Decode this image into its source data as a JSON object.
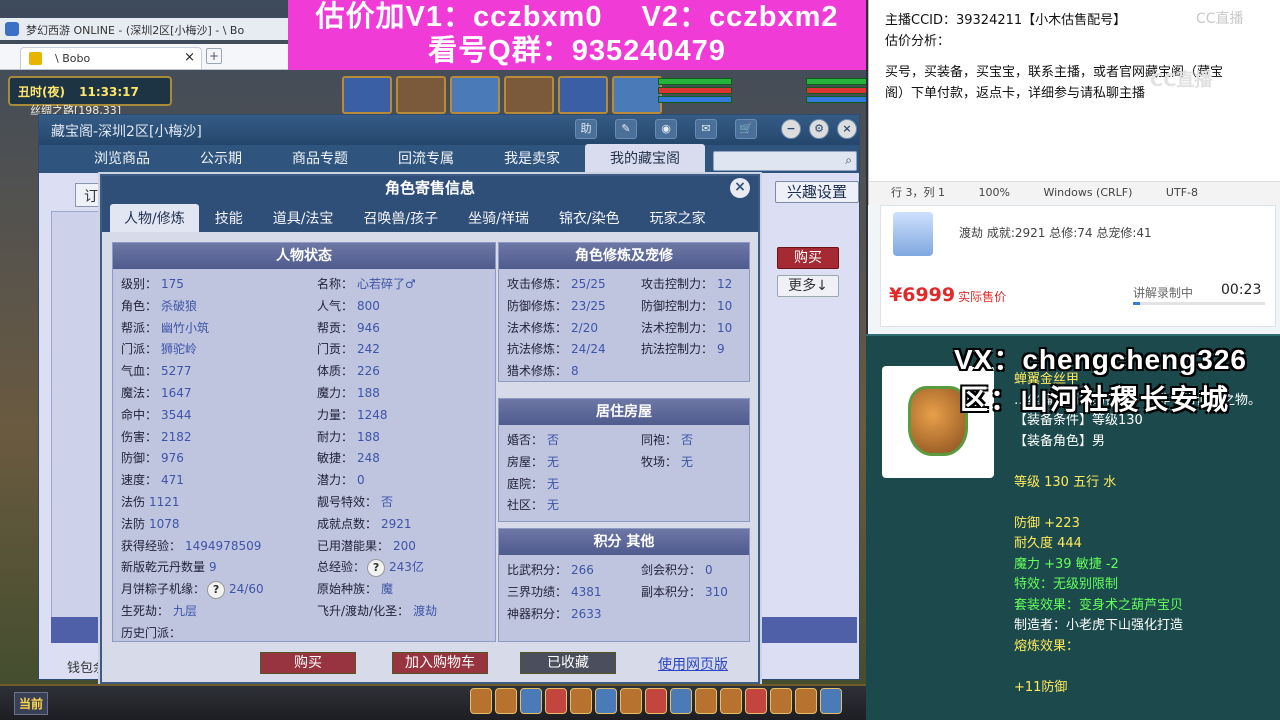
{
  "window": {
    "title": "梦幻西游 ONLINE - (深圳2区[小梅沙] - \\ Bo",
    "tab_label": "\\ Bobo",
    "tab_close": "×",
    "new_tab": "+"
  },
  "banner": {
    "line1": "估价加V1：cczbxm0　 V2：cczbxm2",
    "line2": "看号Q群：935240479"
  },
  "game": {
    "time_period": "丑时(夜)",
    "clock": "11:33:17",
    "map": "丝绸之路[198,33]"
  },
  "cbg": {
    "title": "藏宝阁-深圳2区[小梅沙]",
    "ctl_help": "助",
    "nav_tabs": [
      "浏览商品",
      "公示期",
      "商品专题",
      "回流专属",
      "我是卖家",
      "我的藏宝阁"
    ],
    "left_btn": "订单",
    "interest_btn": "兴趣设置",
    "buy_btn": "购买",
    "more_btn": "更多↓",
    "wallet": "钱包余额"
  },
  "modal": {
    "title": "角色寄售信息",
    "close": "×",
    "tabs": [
      "人物/修炼",
      "技能",
      "道具/法宝",
      "召唤兽/孩子",
      "坐骑/祥瑞",
      "锦衣/染色",
      "玩家之家"
    ],
    "status_header": "人物状态",
    "left_col": [
      {
        "k": "级别：",
        "v": "175"
      },
      {
        "k": "角色：",
        "v": "杀破狼"
      },
      {
        "k": "帮派：",
        "v": "幽竹小筑"
      },
      {
        "k": "门派：",
        "v": "狮驼岭"
      },
      {
        "k": "气血：",
        "v": "5277"
      },
      {
        "k": "魔法：",
        "v": "1647"
      },
      {
        "k": "命中：",
        "v": "3544"
      },
      {
        "k": "伤害：",
        "v": "2182"
      },
      {
        "k": "防御：",
        "v": "976"
      },
      {
        "k": "速度：",
        "v": "471"
      },
      {
        "k": "法伤",
        "v": "1121"
      },
      {
        "k": "法防",
        "v": "1078"
      },
      {
        "k": "获得经验：",
        "v": "1494978509"
      },
      {
        "k": "新版乾元丹数量",
        "v": "9"
      },
      {
        "k": "月饼粽子机缘：",
        "v": "24/60"
      },
      {
        "k": "生死劫：",
        "v": "九层"
      },
      {
        "k": "历史门派：",
        "v": ""
      }
    ],
    "mid_col": [
      {
        "k": "名称：",
        "v": "心若碎了♂"
      },
      {
        "k": "人气：",
        "v": "800"
      },
      {
        "k": "帮贡：",
        "v": "946"
      },
      {
        "k": "门贡：",
        "v": "242"
      },
      {
        "k": "体质：",
        "v": "226"
      },
      {
        "k": "魔力：",
        "v": "188"
      },
      {
        "k": "力量：",
        "v": "1248"
      },
      {
        "k": "耐力：",
        "v": "188"
      },
      {
        "k": "敏捷：",
        "v": "248"
      },
      {
        "k": "潜力：",
        "v": "0"
      },
      {
        "k": "靓号特效：",
        "v": "否"
      },
      {
        "k": "成就点数：",
        "v": "2921"
      },
      {
        "k": "已用潜能果：",
        "v": "200"
      },
      {
        "k": "总经验：",
        "v": "243亿"
      },
      {
        "k": "原始种族：",
        "v": "魔"
      },
      {
        "k": "飞升/渡劫/化圣：",
        "v": "渡劫"
      }
    ],
    "cultivation_header": "角色修炼及宠修",
    "cultivation": [
      {
        "k": "攻击修炼：",
        "v": "25/25",
        "k2": "攻击控制力：",
        "v2": "12"
      },
      {
        "k": "防御修炼：",
        "v": "23/25",
        "k2": "防御控制力：",
        "v2": "10"
      },
      {
        "k": "法术修炼：",
        "v": "2/20",
        "k2": "法术控制力：",
        "v2": "10"
      },
      {
        "k": "抗法修炼：",
        "v": "24/24",
        "k2": "抗法控制力：",
        "v2": "9"
      },
      {
        "k": "猎术修炼：",
        "v": "8",
        "k2": "",
        "v2": ""
      }
    ],
    "house_header": "居住房屋",
    "house": [
      {
        "k": "婚否：",
        "v": "否",
        "k2": "同袍：",
        "v2": "否"
      },
      {
        "k": "房屋：",
        "v": "无",
        "k2": "牧场：",
        "v2": "无"
      },
      {
        "k": "庭院：",
        "v": "无",
        "k2": "",
        "v2": ""
      },
      {
        "k": "社区：",
        "v": "无",
        "k2": "",
        "v2": ""
      }
    ],
    "score_header": "积分 其他",
    "score": [
      {
        "k": "比武积分：",
        "v": "266",
        "k2": "剑会积分：",
        "v2": "0"
      },
      {
        "k": "三界功绩：",
        "v": "4381",
        "k2": "副本积分：",
        "v2": "310"
      },
      {
        "k": "神器积分：",
        "v": "2633",
        "k2": "",
        "v2": ""
      }
    ],
    "btn_buy": "购买",
    "btn_cart": "加入购物车",
    "btn_collected": "已收藏",
    "link_web": "使用网页版",
    "help_q": "?"
  },
  "bottombar": {
    "current": "当前"
  },
  "notepad": {
    "line1": "主播CCID：39324211【小木估售配号】",
    "line2": "估价分析：",
    "line3": "买号，买装备，买宝宝，联系主播，或者官网藏宝阁（藏宝",
    "line4": "阁）下单付款，返点卡，详细参与请私聊主播",
    "status_pos": "行 3，列 1",
    "status_zoom": "100%",
    "status_eol": "Windows (CRLF)",
    "status_enc": "UTF-8",
    "watermark": "CC直播",
    "watermark_big": "CC直播"
  },
  "shop": {
    "summary": "渡劫 成就:2921 总修:74 总宠修:41",
    "price": "¥6999",
    "price_note": "实际售价",
    "record_label": "讲解录制中",
    "record_time": "00:23",
    "record_progress": 0.05
  },
  "tooltip": {
    "overlay_vx": "VX：chengcheng326",
    "overlay_qu": "区：山河社稷长安城",
    "lines": [
      {
        "t": "蝉翼金丝甲",
        "c": "c-yellow"
      },
      {
        "t": "…丝编织而成的铠甲，绝非寻常仙家之物。",
        "c": ""
      },
      {
        "t": "【装备条件】等级130",
        "c": ""
      },
      {
        "t": "【装备角色】男",
        "c": ""
      },
      {
        "t": "",
        "c": ""
      },
      {
        "t": "等级 130 五行 水",
        "c": "c-yellow"
      },
      {
        "t": "",
        "c": ""
      },
      {
        "t": "防御 +223",
        "c": "c-yellow"
      },
      {
        "t": "耐久度 444",
        "c": "c-yellow"
      },
      {
        "t": "魔力 +39 敏捷 -2",
        "c": "c-green"
      },
      {
        "t": "特效：无级别限制",
        "c": "c-green"
      },
      {
        "t": "套装效果：变身术之葫芦宝贝",
        "c": "c-green"
      },
      {
        "t": "制造者：小老虎下山强化打造",
        "c": ""
      },
      {
        "t": "熔炼效果：",
        "c": "c-yellow"
      },
      {
        "t": "",
        "c": ""
      },
      {
        "t": "+11防御",
        "c": "c-yellow"
      }
    ]
  }
}
